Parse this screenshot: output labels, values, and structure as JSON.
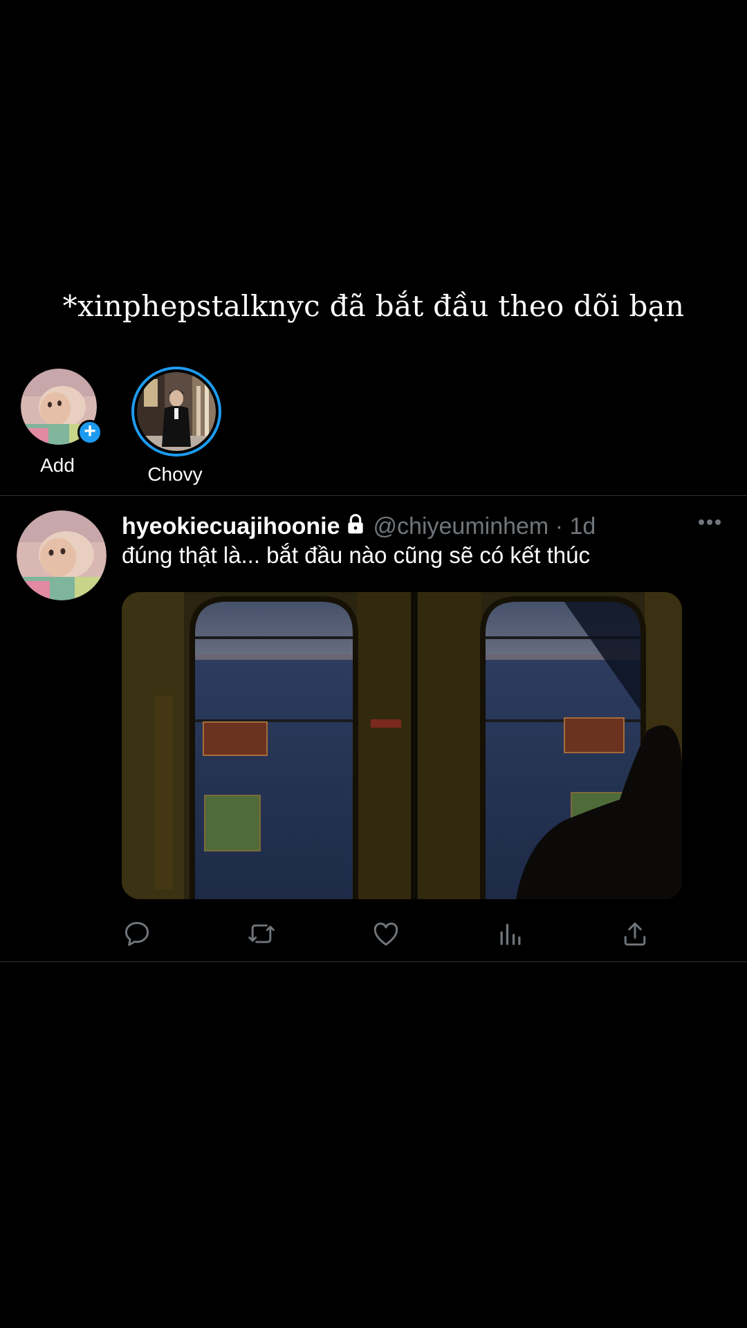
{
  "caption": "*xinphepstalknyc đã bắt đầu theo dõi bạn",
  "fleets": [
    {
      "label": "Add"
    },
    {
      "label": "Chovy"
    }
  ],
  "tweet": {
    "display_name": "hyeokiecuajihoonie",
    "handle": "@chiyeuminhem",
    "separator": "·",
    "time": "1d",
    "text": "đúng thật là... bắt đầu nào cũng sẽ có kết thúc",
    "protected_icon": "lock-icon",
    "media_alt": "train-window-photo"
  },
  "actions": [
    "reply-icon",
    "retweet-icon",
    "like-icon",
    "analytics-icon",
    "share-icon"
  ],
  "colors": {
    "background": "#000000",
    "accent": "#1d9bf0",
    "secondary_text": "#71767b",
    "divider": "#2f3336"
  }
}
